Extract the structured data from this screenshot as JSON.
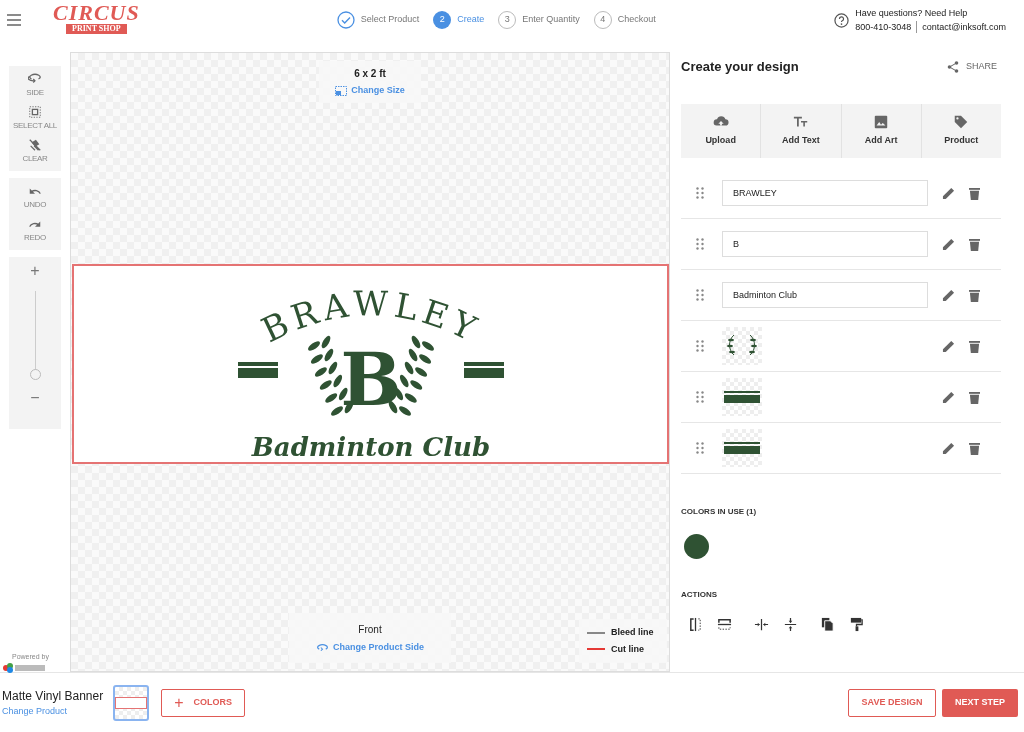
{
  "header": {
    "logo": {
      "title": "CIRCUS",
      "subtitle": "PRINT SHOP"
    },
    "steps": [
      {
        "label": "Select Product",
        "completed": true,
        "selected": false
      },
      {
        "number": "2",
        "label": "Create",
        "completed": false,
        "selected": true
      },
      {
        "number": "3",
        "label": "Enter Quantity",
        "completed": false,
        "selected": false
      },
      {
        "number": "4",
        "label": "Checkout",
        "completed": false,
        "selected": false
      }
    ],
    "help": {
      "question": "Have questions? Need Help",
      "phone": "800-410-3048",
      "email": "contact@inksoft.com"
    }
  },
  "toolbar": {
    "groups": [
      [
        {
          "kind": "side",
          "label": "SIDE"
        },
        {
          "kind": "select",
          "label": "SELECT ALL"
        },
        {
          "kind": "clear",
          "label": "CLEAR"
        }
      ],
      [
        {
          "kind": "undo",
          "label": "UNDO"
        },
        {
          "kind": "redo",
          "label": "REDO"
        }
      ]
    ],
    "zoom": {
      "plus": "+",
      "minus": "−",
      "level": 0
    }
  },
  "canvas": {
    "size": "6 x 2 ft",
    "change_size": "Change Size",
    "design": {
      "top": "BRAWLEY",
      "initial": "B",
      "script": "Badminton Club"
    },
    "side": "Front",
    "change_side": "Change Product Side",
    "legend": [
      {
        "label": "Bleed line",
        "color": "#888888"
      },
      {
        "label": "Cut line",
        "color": "#e53935"
      }
    ],
    "powered_by": "Powered by"
  },
  "panel": {
    "title": "Create your design",
    "share": "SHARE",
    "tools": [
      {
        "kind": "upload",
        "label": "Upload"
      },
      {
        "kind": "text",
        "label": "Add Text"
      },
      {
        "kind": "art",
        "label": "Add Art"
      },
      {
        "kind": "product",
        "label": "Product"
      }
    ],
    "layers": [
      {
        "kind": "text",
        "value": "BRAWLEY"
      },
      {
        "kind": "text",
        "value": "B"
      },
      {
        "kind": "text",
        "value": "Badminton Club"
      },
      {
        "kind": "wreath"
      },
      {
        "kind": "stripe"
      },
      {
        "kind": "stripe"
      }
    ],
    "colors_title": "COLORS IN USE (1)",
    "colors": [
      {
        "color": "#2f5233"
      }
    ],
    "actions_title": "ACTIONS"
  },
  "footer": {
    "product": "Matte Vinyl Banner",
    "change_product": "Change Product",
    "colors_button": "COLORS",
    "plus": "+",
    "save": "SAVE DESIGN",
    "next": "NEXT STEP"
  }
}
